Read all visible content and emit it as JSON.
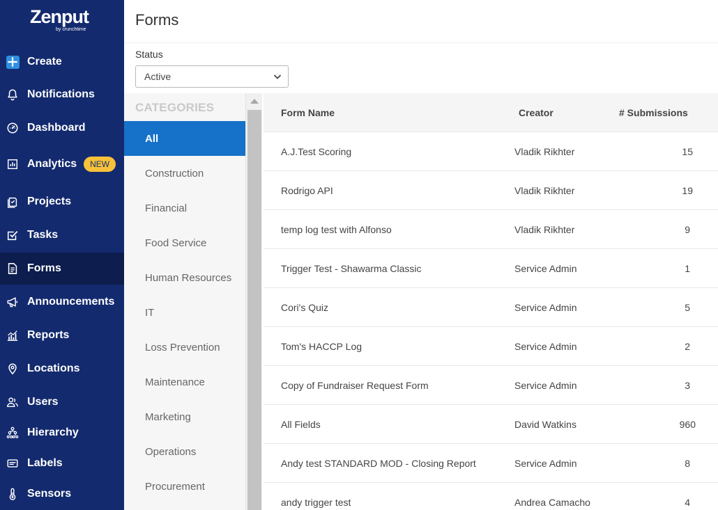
{
  "brand": {
    "logo_text": "Zenput",
    "logo_sub": "by crunchtime"
  },
  "sidebar": {
    "items": [
      {
        "id": "create",
        "label": "Create",
        "icon": "plus-icon"
      },
      {
        "id": "notifications",
        "label": "Notifications",
        "icon": "bell-icon"
      },
      {
        "id": "dashboard",
        "label": "Dashboard",
        "icon": "gauge-icon"
      },
      {
        "id": "analytics",
        "label": "Analytics",
        "icon": "chart-icon",
        "badge": "NEW"
      },
      {
        "id": "projects",
        "label": "Projects",
        "icon": "clipboard-icon"
      },
      {
        "id": "tasks",
        "label": "Tasks",
        "icon": "checkbox-icon"
      },
      {
        "id": "forms",
        "label": "Forms",
        "icon": "document-icon",
        "active": true
      },
      {
        "id": "announcements",
        "label": "Announcements",
        "icon": "megaphone-icon"
      },
      {
        "id": "reports",
        "label": "Reports",
        "icon": "bar-chart-icon"
      },
      {
        "id": "locations",
        "label": "Locations",
        "icon": "map-pin-icon"
      },
      {
        "id": "users",
        "label": "Users",
        "icon": "users-icon"
      },
      {
        "id": "hierarchy",
        "label": "Hierarchy",
        "icon": "hierarchy-icon"
      },
      {
        "id": "labels",
        "label": "Labels",
        "icon": "label-icon"
      },
      {
        "id": "sensors",
        "label": "Sensors",
        "icon": "thermometer-icon"
      }
    ]
  },
  "header": {
    "title": "Forms"
  },
  "filter": {
    "status_label": "Status",
    "status_value": "Active"
  },
  "categories": {
    "heading": "CATEGORIES",
    "items": [
      {
        "label": "All",
        "active": true
      },
      {
        "label": "Construction"
      },
      {
        "label": "Financial"
      },
      {
        "label": "Food Service"
      },
      {
        "label": "Human Resources"
      },
      {
        "label": "IT"
      },
      {
        "label": "Loss Prevention"
      },
      {
        "label": "Maintenance"
      },
      {
        "label": "Marketing"
      },
      {
        "label": "Operations"
      },
      {
        "label": "Procurement"
      }
    ]
  },
  "table": {
    "columns": {
      "name": "Form Name",
      "creator": "Creator",
      "submissions": "# Submissions"
    },
    "rows": [
      {
        "name": "A.J.Test Scoring",
        "creator": "Vladik Rikhter",
        "submissions": "15"
      },
      {
        "name": "Rodrigo API",
        "creator": "Vladik Rikhter",
        "submissions": "19"
      },
      {
        "name": "temp log test with Alfonso",
        "creator": "Vladik Rikhter",
        "submissions": "9"
      },
      {
        "name": "Trigger Test - Shawarma Classic",
        "creator": "Service Admin",
        "submissions": "1"
      },
      {
        "name": "Cori's Quiz",
        "creator": "Service Admin",
        "submissions": "5"
      },
      {
        "name": "Tom's HACCP Log",
        "creator": "Service Admin",
        "submissions": "2"
      },
      {
        "name": "Copy of Fundraiser Request Form",
        "creator": "Service Admin",
        "submissions": "3"
      },
      {
        "name": "All Fields",
        "creator": "David Watkins",
        "submissions": "960"
      },
      {
        "name": "Andy test STANDARD MOD - Closing Report",
        "creator": "Service Admin",
        "submissions": "8"
      },
      {
        "name": "andy trigger test",
        "creator": "Andrea Camacho",
        "submissions": "4"
      }
    ]
  },
  "colors": {
    "sidebar_bg": "#132a6e",
    "sidebar_active": "#0c1d4e",
    "accent": "#1671c8",
    "badge": "#f7c23a"
  }
}
